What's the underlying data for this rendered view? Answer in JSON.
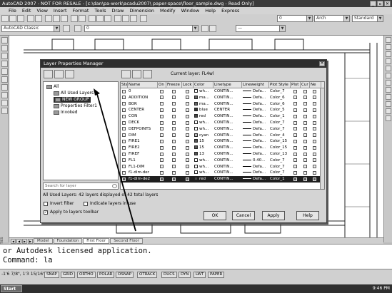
{
  "app": {
    "title": "AutoCAD 2007 - NOT FOR RESALE - [c:\\dan\\pa-work\\acadu2007\\ paper-space\\floor_sample.dwg - Read Only]",
    "window_buttons": [
      "_",
      "▫",
      "✕"
    ]
  },
  "menu": [
    "File",
    "Edit",
    "View",
    "Insert",
    "Format",
    "Tools",
    "Draw",
    "Dimension",
    "Modify",
    "Window",
    "Help",
    "Express"
  ],
  "toolbar": {
    "workspace": "AutoCAD Classic",
    "layer_combo": "0",
    "color_combo": "—",
    "linetype_combo": "Arch",
    "style_combo": "Standard"
  },
  "dialog": {
    "title": "Layer Properties Manager",
    "close": "✕",
    "current_layer_label": "Current layer: FL4wl",
    "tree": [
      {
        "label": "All",
        "selected": false
      },
      {
        "label": "All Used Layers",
        "selected": false
      },
      {
        "label": "NEW GROUP",
        "selected": true
      },
      {
        "label": "Properties Filter1",
        "selected": false
      },
      {
        "label": "Invoked",
        "selected": false
      }
    ],
    "search_placeholder": "Search for layer",
    "summary": "All Used Layers: 42 layers displayed of 42 total layers",
    "checks": {
      "invert_filter": "Invert filter",
      "indicate_layers": "Indicate layers in use",
      "apply_toolbar": "Apply to layers toolbar"
    },
    "buttons": {
      "ok": "OK",
      "cancel": "Cancel",
      "apply": "Apply",
      "help": "Help"
    },
    "columns": [
      "Stat",
      "Name",
      "On",
      "Freeze",
      "Lock",
      "Color",
      "Linetype",
      "Lineweight",
      "Plot Style",
      "Plot",
      "Cur",
      "Ne"
    ],
    "rows": [
      {
        "name": "0",
        "color": "wh...",
        "swatch": "#ffffff",
        "linetype": "CONTIN...",
        "lineweight": "Defa...",
        "plotstyle": "Color_7",
        "selected": false
      },
      {
        "name": "ADDITION",
        "color": "ma...",
        "swatch": "#666666",
        "linetype": "CONTIN...",
        "lineweight": "Defa...",
        "plotstyle": "Color_6",
        "selected": false
      },
      {
        "name": "BOR",
        "color": "ma...",
        "swatch": "#666666",
        "linetype": "CONTIN...",
        "lineweight": "Defa...",
        "plotstyle": "Color_6",
        "selected": false
      },
      {
        "name": "CENTER",
        "color": "blue",
        "swatch": "#333333",
        "linetype": "CENTER",
        "lineweight": "Defa...",
        "plotstyle": "Color_5",
        "selected": false
      },
      {
        "name": "CON",
        "color": "red",
        "swatch": "#444444",
        "linetype": "CONTIN...",
        "lineweight": "Defa...",
        "plotstyle": "Color_1",
        "selected": false
      },
      {
        "name": "DECK",
        "color": "wh...",
        "swatch": "#ffffff",
        "linetype": "CONTIN...",
        "lineweight": "Defa...",
        "plotstyle": "Color_7",
        "selected": false
      },
      {
        "name": "DEFPOINTS",
        "color": "wh...",
        "swatch": "#ffffff",
        "linetype": "CONTIN...",
        "lineweight": "Defa...",
        "plotstyle": "Color_7",
        "selected": false
      },
      {
        "name": "DIM",
        "color": "cyan",
        "swatch": "#bbbbbb",
        "linetype": "CONTIN...",
        "lineweight": "Defa...",
        "plotstyle": "Color_4",
        "selected": false
      },
      {
        "name": "FIRE1",
        "color": "15",
        "swatch": "#555555",
        "linetype": "CONTIN...",
        "lineweight": "Defa...",
        "plotstyle": "Color_15",
        "selected": false
      },
      {
        "name": "FIRE2",
        "color": "15",
        "swatch": "#555555",
        "linetype": "CONTIN...",
        "lineweight": "Defa...",
        "plotstyle": "Color_15",
        "selected": false
      },
      {
        "name": "FIREF",
        "color": "13",
        "swatch": "#555555",
        "linetype": "CONTIN...",
        "lineweight": "Defa...",
        "plotstyle": "Color_13",
        "selected": false
      },
      {
        "name": "FL1",
        "color": "wh...",
        "swatch": "#ffffff",
        "linetype": "CONTIN...",
        "lineweight": "0.40...",
        "plotstyle": "Color_7",
        "selected": false
      },
      {
        "name": "FL1-DIM",
        "color": "wh...",
        "swatch": "#ffffff",
        "linetype": "CONTIN...",
        "lineweight": "Defa...",
        "plotstyle": "Color_7",
        "selected": false
      },
      {
        "name": "f1-dim-der",
        "color": "wh...",
        "swatch": "#ffffff",
        "linetype": "CONTIN...",
        "lineweight": "Defa...",
        "plotstyle": "Color_7",
        "selected": false
      },
      {
        "name": "f1-dim-de2",
        "color": "red",
        "swatch": "#444444",
        "linetype": "CONTIN...",
        "lineweight": "Defa...",
        "plotstyle": "Color_1",
        "selected": true
      }
    ]
  },
  "tabs": [
    "Model",
    "Foundation",
    "First Floor",
    "Second Floor"
  ],
  "nav": [
    "◀",
    "◀",
    "▶",
    "▶"
  ],
  "command": {
    "line1": "or Autodesk licensed application.",
    "line2": "Command: la"
  },
  "status": {
    "coords": "-1'6 7/8\", 1'3 15/16\", 0'-0\"",
    "buttons": [
      "SNAP",
      "GRID",
      "ORTHO",
      "POLAR",
      "OSNAP",
      "OTRACK",
      "DUCS",
      "DYN",
      "LWT",
      "PAPER"
    ]
  },
  "side_label": "PROPERTIES",
  "taskbar": {
    "start": "Start",
    "clock": "9:46 PM"
  }
}
